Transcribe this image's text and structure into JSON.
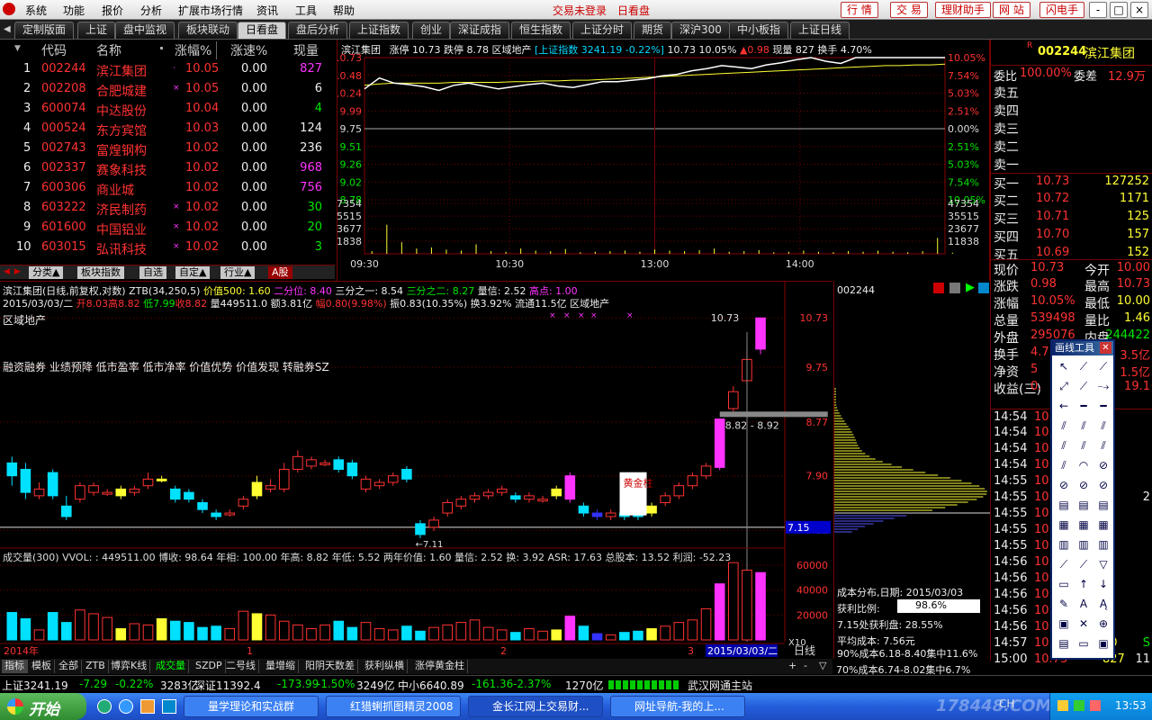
{
  "menubar": {
    "items": [
      "系统",
      "功能",
      "报价",
      "分析",
      "扩展市场行情",
      "资讯",
      "工具",
      "帮助"
    ],
    "login_status": "交易未登录",
    "mode": "日看盘",
    "buttons": [
      "行 情",
      "交 易",
      "理财助手",
      "网 站",
      "闪电手"
    ],
    "window_controls": [
      "-",
      "□",
      "×"
    ]
  },
  "tabs": [
    "定制版面",
    "上证",
    "盘中监视",
    "板块联动",
    "日看盘",
    "盘后分析",
    "上证指数",
    "创业",
    "深证成指",
    "恒生指数",
    "上证分时",
    "期货",
    "深沪300",
    "中小板指",
    "上证日线"
  ],
  "active_tab": "日看盘",
  "quotelist": {
    "headers": [
      "代码",
      "名称",
      "涨幅%",
      "涨速%",
      "现量"
    ],
    "rows": [
      {
        "no": "1",
        "code": "002244",
        "name": "滨江集团",
        "flag": "·",
        "chg": "10.05",
        "speed": "0.00",
        "vol": "827",
        "volc": "mag"
      },
      {
        "no": "2",
        "code": "002208",
        "name": "合肥城建",
        "flag": "×",
        "chg": "10.05",
        "speed": "0.00",
        "vol": "6",
        "volc": "wht"
      },
      {
        "no": "3",
        "code": "600074",
        "name": "中达股份",
        "flag": "",
        "chg": "10.04",
        "speed": "0.00",
        "vol": "4",
        "volc": "grn"
      },
      {
        "no": "4",
        "code": "000524",
        "name": "东方宾馆",
        "flag": "",
        "chg": "10.03",
        "speed": "0.00",
        "vol": "124",
        "volc": "wht"
      },
      {
        "no": "5",
        "code": "002743",
        "name": "富煌钢构",
        "flag": "",
        "chg": "10.02",
        "speed": "0.00",
        "vol": "236",
        "volc": "wht"
      },
      {
        "no": "6",
        "code": "002337",
        "name": "赛象科技",
        "flag": "",
        "chg": "10.02",
        "speed": "0.00",
        "vol": "968",
        "volc": "mag"
      },
      {
        "no": "7",
        "code": "600306",
        "name": "商业城",
        "flag": "",
        "chg": "10.02",
        "speed": "0.00",
        "vol": "756",
        "volc": "mag"
      },
      {
        "no": "8",
        "code": "603222",
        "name": "济民制药",
        "flag": "×",
        "chg": "10.02",
        "speed": "0.00",
        "vol": "30",
        "volc": "grn"
      },
      {
        "no": "9",
        "code": "601600",
        "name": "中国铝业",
        "flag": "×",
        "chg": "10.02",
        "speed": "0.00",
        "vol": "20",
        "volc": "grn"
      },
      {
        "no": "10",
        "code": "603015",
        "name": "弘讯科技",
        "flag": "×",
        "chg": "10.02",
        "speed": "0.00",
        "vol": "3",
        "volc": "grn"
      }
    ],
    "bottom_tabs": [
      "分类▲",
      "板块指数",
      "自选",
      "自定▲",
      "行业▲",
      "A股"
    ]
  },
  "intraday": {
    "header": {
      "name": "滨江集团",
      "limit_up": "涨停 10.73",
      "limit_down": "跌停 8.78",
      "sector": "区域地产",
      "index": "[上证指数 3241.19 -0.22%]",
      "price": "10.73",
      "pct": "10.05%",
      "change": "▲0.98",
      "cur_vol": "现量 827",
      "turnover": "换手 4.70%"
    },
    "price_ticks": [
      "10.73",
      "10.48",
      "10.24",
      "9.99",
      "9.75",
      "9.51",
      "9.26",
      "9.02",
      "8.78"
    ],
    "pct_ticks": [
      "10.05%",
      "7.54%",
      "5.03%",
      "2.51%",
      "0.00%",
      "2.51%",
      "5.03%",
      "7.54%",
      "10.05%"
    ],
    "vol_ticks": [
      "47354",
      "35515",
      "23677",
      "11838"
    ],
    "time_ticks": [
      "09:30",
      "10:30",
      "13:00",
      "14:00"
    ],
    "prev_close": 9.75,
    "price_series": [
      10.3,
      10.45,
      10.38,
      10.36,
      10.33,
      10.28,
      10.35,
      10.38,
      10.34,
      10.3,
      10.33,
      10.36,
      10.38,
      10.34,
      10.32,
      10.36,
      10.4,
      10.4,
      10.42,
      10.44,
      10.48,
      10.5,
      10.55,
      10.58,
      10.62,
      10.6,
      10.58,
      10.63,
      10.66,
      10.7,
      10.73,
      10.68,
      10.65,
      10.73,
      10.73,
      10.73,
      10.73,
      10.73,
      10.73,
      10.73
    ],
    "avg_series": [
      10.35,
      10.37,
      10.38,
      10.38,
      10.38,
      10.38,
      10.39,
      10.39,
      10.39,
      10.39,
      10.4,
      10.4,
      10.41,
      10.41,
      10.42,
      10.42,
      10.43,
      10.44,
      10.45,
      10.46,
      10.47,
      10.48,
      10.49,
      10.5,
      10.51,
      10.52,
      10.53,
      10.54,
      10.55,
      10.56,
      10.57,
      10.58,
      10.59,
      10.6,
      10.61,
      10.62,
      10.62,
      10.63,
      10.63,
      10.64
    ],
    "volume_series": [
      0.05,
      0.55,
      0.22,
      0.1,
      0.12,
      0.08,
      0.06,
      0.18,
      0.05,
      0.04,
      0.1,
      0.06,
      0.05,
      0.09,
      0.03,
      0.04,
      0.05,
      0.06,
      0.04,
      0.08,
      0.06,
      0.05,
      0.07,
      0.1,
      0.04,
      0.05,
      0.07,
      0.03,
      0.04,
      0.06,
      0.04,
      0.03,
      0.05,
      0.04,
      0.06,
      0.04,
      0.03,
      0.05,
      0.3,
      0.02
    ]
  },
  "kline": {
    "header1": {
      "name": "滨江集团(日线,前复权,对数) ZTB(34,250,5)",
      "p500": "价值500: 1.60",
      "q2": "二分位: 8.40",
      "q3": "三分之一: 8.54",
      "q23": "三分之二: 8.27",
      "vr": "量信: 2.52",
      "hi": "高点: 1.00"
    },
    "header2": {
      "date": "2015/03/03/二",
      "open": "开8.03",
      "high": "高8.82",
      "low": "低7.99",
      "close": "收8.82",
      "vol": "量449511.0",
      "amt": "额3.81亿",
      "amp": "幅0.80(9.98%)",
      "zf": "振0.83(10.35%)",
      "hs": "换3.92%",
      "ltv": "流通11.5亿",
      "sector": "区域地产"
    },
    "sector_label": "区域地产",
    "concepts": "融资融券 业绩预降 低市盈率 低市净率 价值优势 价值发现 转融券SZ",
    "price_axis": [
      "10.73",
      "9.75",
      "8.77",
      "7.90",
      "7.11"
    ],
    "current_price_tag": "7.15",
    "last_high_label": "10.73",
    "range_label": "8.82 - 8.92",
    "gold_label": "黄金柱",
    "low_label": "←7.11",
    "vol_header": "成交量(300) VVOL: : 449511.00 博收: 98.64 年相: 100.00 年高: 8.82 年低: 5.52 两年价值: 1.60 量信: 2.52 换: 3.92 ASR: 17.63 总股本: 13.52 利润: -52.23",
    "vol_axis": [
      "60000",
      "40000",
      "20000",
      "X10"
    ],
    "date_axis": [
      "2014年",
      "1",
      "2",
      "3"
    ],
    "date_tag": "2015/03/03/二",
    "period": "日线"
  },
  "chart_data": {
    "type": "candlestick",
    "period": "日线",
    "candles": [
      {
        "o": 7.9,
        "c": 8.1,
        "h": 8.2,
        "l": 7.75,
        "col": "cyan"
      },
      {
        "o": 8.0,
        "c": 7.65,
        "h": 8.1,
        "l": 7.55,
        "col": "cyan"
      },
      {
        "o": 7.7,
        "c": 7.6,
        "h": 7.8,
        "l": 7.55,
        "col": "red"
      },
      {
        "o": 7.6,
        "c": 7.95,
        "h": 8.0,
        "l": 7.55,
        "col": "cyan"
      },
      {
        "o": 7.45,
        "c": 7.3,
        "h": 7.6,
        "l": 7.25,
        "col": "cyan"
      },
      {
        "o": 7.55,
        "c": 7.75,
        "h": 7.8,
        "l": 7.5,
        "col": "red"
      },
      {
        "o": 7.65,
        "c": 7.75,
        "h": 7.8,
        "l": 7.6,
        "col": "red"
      },
      {
        "o": 7.65,
        "c": 7.65,
        "h": 7.7,
        "l": 7.6,
        "col": "red"
      },
      {
        "o": 7.6,
        "c": 7.7,
        "h": 7.75,
        "l": 7.55,
        "col": "yellow"
      },
      {
        "o": 7.65,
        "c": 7.7,
        "h": 7.75,
        "l": 7.6,
        "col": "red"
      },
      {
        "o": 7.75,
        "c": 7.85,
        "h": 7.95,
        "l": 7.7,
        "col": "red"
      },
      {
        "o": 7.85,
        "c": 7.85,
        "h": 7.9,
        "l": 7.8,
        "col": "yellow"
      },
      {
        "o": 7.55,
        "c": 7.7,
        "h": 7.75,
        "l": 7.5,
        "col": "cyan"
      },
      {
        "o": 7.65,
        "c": 7.55,
        "h": 7.7,
        "l": 7.5,
        "col": "cyan"
      },
      {
        "o": 7.5,
        "c": 7.4,
        "h": 7.55,
        "l": 7.35,
        "col": "cyan"
      },
      {
        "o": 7.35,
        "c": 7.3,
        "h": 7.4,
        "l": 7.25,
        "col": "cyan"
      },
      {
        "o": 7.35,
        "c": 7.35,
        "h": 7.4,
        "l": 7.3,
        "col": "red"
      },
      {
        "o": 7.45,
        "c": 7.55,
        "h": 7.6,
        "l": 7.4,
        "col": "red"
      },
      {
        "o": 7.6,
        "c": 7.8,
        "h": 7.9,
        "l": 7.55,
        "col": "yellow"
      },
      {
        "o": 7.7,
        "c": 7.75,
        "h": 7.85,
        "l": 7.65,
        "col": "red"
      },
      {
        "o": 7.7,
        "c": 8.0,
        "h": 8.1,
        "l": 7.65,
        "col": "red"
      },
      {
        "o": 8.0,
        "c": 8.2,
        "h": 8.3,
        "l": 7.95,
        "col": "red"
      },
      {
        "o": 8.15,
        "c": 8.05,
        "h": 8.2,
        "l": 8.0,
        "col": "red"
      },
      {
        "o": 8.1,
        "c": 8.1,
        "h": 8.15,
        "l": 8.05,
        "col": "red"
      },
      {
        "o": 8.0,
        "c": 8.15,
        "h": 8.2,
        "l": 7.95,
        "col": "cyan"
      },
      {
        "o": 8.1,
        "c": 7.9,
        "h": 8.15,
        "l": 7.85,
        "col": "cyan"
      },
      {
        "o": 7.7,
        "c": 7.85,
        "h": 7.9,
        "l": 7.65,
        "col": "red"
      },
      {
        "o": 7.75,
        "c": 7.8,
        "h": 7.85,
        "l": 7.7,
        "col": "red"
      },
      {
        "o": 7.8,
        "c": 7.9,
        "h": 7.95,
        "l": 7.75,
        "col": "red"
      },
      {
        "o": 7.85,
        "c": 8.0,
        "h": 8.05,
        "l": 7.8,
        "col": "cyan"
      },
      {
        "o": 7.2,
        "c": 7.05,
        "h": 7.25,
        "l": 7.0,
        "col": "cyan"
      },
      {
        "o": 7.15,
        "c": 7.25,
        "h": 7.3,
        "l": 7.1,
        "col": "red"
      },
      {
        "o": 7.35,
        "c": 7.5,
        "h": 7.55,
        "l": 7.3,
        "col": "red"
      },
      {
        "o": 7.45,
        "c": 7.55,
        "h": 7.6,
        "l": 7.4,
        "col": "red"
      },
      {
        "o": 7.55,
        "c": 7.6,
        "h": 7.65,
        "l": 7.5,
        "col": "red"
      },
      {
        "o": 7.6,
        "c": 7.65,
        "h": 7.7,
        "l": 7.55,
        "col": "red"
      },
      {
        "o": 7.65,
        "c": 7.7,
        "h": 7.75,
        "l": 7.6,
        "col": "red"
      },
      {
        "o": 7.6,
        "c": 7.55,
        "h": 7.65,
        "l": 7.5,
        "col": "cyan"
      },
      {
        "o": 7.55,
        "c": 7.6,
        "h": 7.65,
        "l": 7.5,
        "col": "red"
      },
      {
        "o": 7.55,
        "c": 7.55,
        "h": 7.6,
        "l": 7.5,
        "col": "red"
      },
      {
        "o": 7.6,
        "c": 7.7,
        "h": 7.75,
        "l": 7.55,
        "col": "yellow"
      },
      {
        "o": 7.55,
        "c": 7.9,
        "h": 7.95,
        "l": 7.5,
        "col": "magenta"
      },
      {
        "o": 7.45,
        "c": 7.35,
        "h": 7.5,
        "l": 7.3,
        "col": "cyan"
      },
      {
        "o": 7.35,
        "c": 7.3,
        "h": 7.4,
        "l": 7.25,
        "col": "blue"
      },
      {
        "o": 7.3,
        "c": 7.35,
        "h": 7.4,
        "l": 7.25,
        "col": "red"
      },
      {
        "o": 7.35,
        "c": 7.3,
        "h": 7.4,
        "l": 7.25,
        "col": "cyan"
      },
      {
        "o": 7.3,
        "c": 7.35,
        "h": 7.4,
        "l": 7.25,
        "col": "cyan"
      },
      {
        "o": 7.35,
        "c": 7.45,
        "h": 7.5,
        "l": 7.3,
        "col": "yellow"
      },
      {
        "o": 7.5,
        "c": 7.6,
        "h": 7.65,
        "l": 7.45,
        "col": "red"
      },
      {
        "o": 7.6,
        "c": 7.75,
        "h": 7.8,
        "l": 7.55,
        "col": "red"
      },
      {
        "o": 7.75,
        "c": 7.9,
        "h": 7.95,
        "l": 7.7,
        "col": "red"
      },
      {
        "o": 7.9,
        "c": 8.05,
        "h": 8.1,
        "l": 7.85,
        "col": "red"
      },
      {
        "o": 8.03,
        "c": 8.82,
        "h": 8.82,
        "l": 7.99,
        "col": "magenta"
      },
      {
        "o": 9.0,
        "c": 9.3,
        "h": 9.4,
        "l": 8.95,
        "col": "red"
      },
      {
        "o": 9.5,
        "c": 9.9,
        "h": 10.1,
        "l": 9.4,
        "col": "red"
      },
      {
        "o": 10.1,
        "c": 10.73,
        "h": 10.73,
        "l": 10.0,
        "col": "magenta"
      }
    ],
    "volumes": [
      22000,
      17000,
      8000,
      22000,
      14000,
      24000,
      21000,
      18000,
      9000,
      13000,
      12000,
      17000,
      15000,
      14000,
      10000,
      11000,
      9000,
      23000,
      21000,
      20000,
      15000,
      12000,
      9000,
      12000,
      15000,
      10000,
      14000,
      9000,
      8000,
      11000,
      7000,
      10000,
      12000,
      14000,
      16000,
      10000,
      8000,
      6000,
      9000,
      7000,
      8000,
      19000,
      11000,
      5000,
      4000,
      6000,
      7000,
      9000,
      11000,
      14000,
      16000,
      25000,
      45000,
      62000,
      56000,
      54000
    ],
    "vol_ylim": [
      0,
      65000
    ],
    "ylim_log": [
      7.0,
      11.0
    ]
  },
  "rightpanel": {
    "code": "002244",
    "name": "滨江集团",
    "weibi_label": "委比",
    "weibi": "100.00%",
    "weicha_label": "委差",
    "weicha": "12.9万",
    "asks": [
      {
        "l": "卖五",
        "p": "",
        "v": ""
      },
      {
        "l": "卖四",
        "p": "",
        "v": ""
      },
      {
        "l": "卖三",
        "p": "",
        "v": ""
      },
      {
        "l": "卖二",
        "p": "",
        "v": ""
      },
      {
        "l": "卖一",
        "p": "",
        "v": ""
      }
    ],
    "bids": [
      {
        "l": "买一",
        "p": "10.73",
        "v": "127252"
      },
      {
        "l": "买二",
        "p": "10.72",
        "v": "1171"
      },
      {
        "l": "买三",
        "p": "10.71",
        "v": "125"
      },
      {
        "l": "买四",
        "p": "10.70",
        "v": "157"
      },
      {
        "l": "买五",
        "p": "10.69",
        "v": "152"
      }
    ],
    "stats": [
      {
        "a": "现价",
        "av": "10.73",
        "b": "今开",
        "bv": "10.00"
      },
      {
        "a": "涨跌",
        "av": "0.98",
        "b": "最高",
        "bv": "10.73"
      },
      {
        "a": "涨幅",
        "av": "10.05%",
        "b": "最低",
        "bv": "10.00"
      },
      {
        "a": "总量",
        "av": "539498",
        "b": "量比",
        "bv": "1.46"
      },
      {
        "a": "外盘",
        "av": "295076",
        "b": "内盘",
        "bv": "244422"
      },
      {
        "a": "换手",
        "av": "4.7",
        "b": "",
        "bv": "3.5亿"
      },
      {
        "a": "净资",
        "av": "5",
        "b": "",
        "bv": "1.5亿"
      },
      {
        "a": "收益(三)",
        "av": "0.",
        "b": "",
        "bv": "19.1"
      }
    ],
    "ticks": [
      {
        "t": "14:54",
        "p": "10.73",
        "v": "",
        "f": ""
      },
      {
        "t": "14:54",
        "p": "10.73",
        "v": "",
        "f": ""
      },
      {
        "t": "14:54",
        "p": "10.73",
        "v": "",
        "f": ""
      },
      {
        "t": "14:54",
        "p": "10.73",
        "v": "",
        "f": ""
      },
      {
        "t": "14:55",
        "p": "10.73",
        "v": "",
        "f": ""
      },
      {
        "t": "14:55",
        "p": "10.73",
        "v": "",
        "f": "2"
      },
      {
        "t": "14:55",
        "p": "10.73",
        "v": "",
        "f": ""
      },
      {
        "t": "14:55",
        "p": "10.73",
        "v": "",
        "f": ""
      },
      {
        "t": "14:55",
        "p": "10.73",
        "v": "",
        "f": ""
      },
      {
        "t": "14:56",
        "p": "10.73",
        "v": "",
        "f": ""
      },
      {
        "t": "14:56",
        "p": "10.73",
        "v": "",
        "f": ""
      },
      {
        "t": "14:56",
        "p": "10.73",
        "v": "",
        "f": ""
      },
      {
        "t": "14:56",
        "p": "10.73",
        "v": "",
        "f": ""
      },
      {
        "t": "14:56",
        "p": "10.73",
        "v": "",
        "f": ""
      },
      {
        "t": "14:57",
        "p": "10.73",
        "v": "40",
        "f": "S"
      },
      {
        "t": "15:00",
        "p": "10.73",
        "v": "827",
        "f": "11"
      }
    ]
  },
  "profile": {
    "code": "002244",
    "title": "成本分布,日期: 2015/03/03",
    "profit_label": "获利比例:",
    "profit": "98.6%",
    "profit_at": "7.15处获利盘: 28.55%",
    "avg_cost": "平均成本: 7.56元",
    "c90": "90%成本6.18-8.40集中11.6%",
    "c70": "70%成本6.74-8.02集中6.7%"
  },
  "drawtool": {
    "title": "画线工具"
  },
  "bottom_tabs": [
    "指标",
    "模板",
    "全部",
    "ZTB",
    "博弈K线",
    "成交量",
    "SZDP",
    "二号线",
    "量增缩",
    "阳阴天数差",
    "获利纵横",
    "涨停黄金柱"
  ],
  "statusbar": {
    "sh": "上证3241.19",
    "sh_chg": "-7.29",
    "sh_pct": "-0.22%",
    "sh_amt": "3283亿",
    "sz": "深证11392.4",
    "sz_chg": "-173.99",
    "sz_pct": "-1.50%",
    "sz_amt": "3249亿",
    "zx": "中小6640.89",
    "zx_chg": "-161.36",
    "zx_pct": "-2.37%",
    "zx_amt": "1270亿",
    "server": "武汉网通主站"
  },
  "taskbar": {
    "start": "开始",
    "items": [
      "量学理论和实战群",
      "红猎蜊抓图精灵2008",
      "金长江网上交易财...",
      "网址导航-我的上..."
    ],
    "clock": "13:53",
    "watermark": "178448.COM",
    "lang": "CH"
  }
}
